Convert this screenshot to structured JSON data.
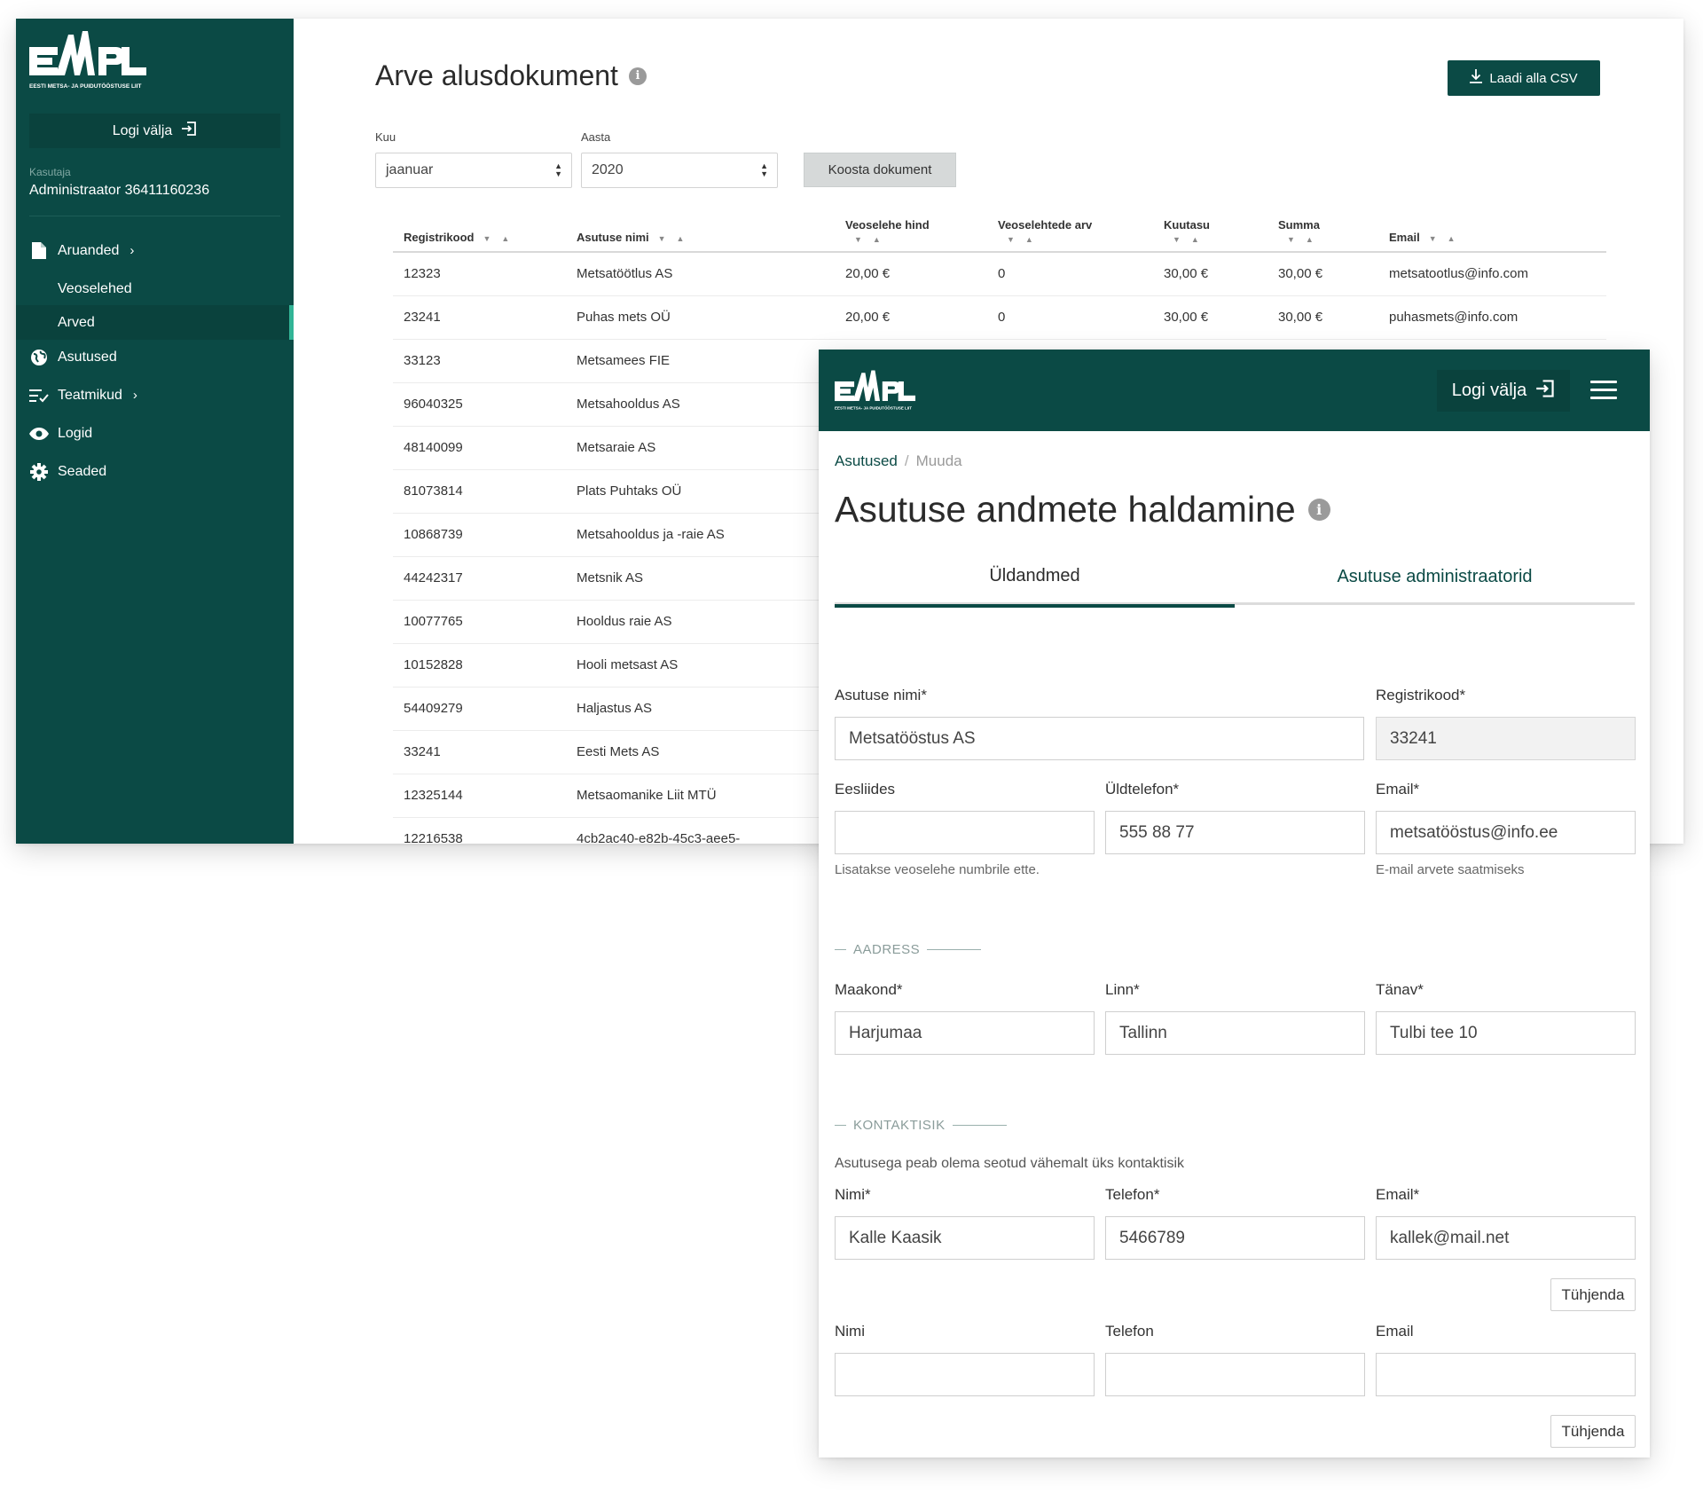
{
  "brand": {
    "logo_text": "EMPL",
    "logo_subtitle": "EESTI METSA- JA PUIDUTÖÖSTUSE LIIT",
    "primary_color": "#0b4a45",
    "accent_color": "#32b496"
  },
  "sidebar": {
    "logout_label": "Logi välja",
    "user_label": "Kasutaja",
    "user_name": "Administraator 36411160236",
    "items": [
      {
        "label": "Aruanded",
        "icon": "document-icon",
        "has_chevron": true
      },
      {
        "label": "Veoselehed",
        "sub": true
      },
      {
        "label": "Arved",
        "sub": true,
        "active": true
      },
      {
        "label": "Asutused",
        "icon": "globe-icon"
      },
      {
        "label": "Teatmikud",
        "icon": "checklist-icon",
        "has_chevron": true
      },
      {
        "label": "Logid",
        "icon": "eye-icon"
      },
      {
        "label": "Seaded",
        "icon": "gear-icon"
      }
    ]
  },
  "invoice": {
    "title": "Arve alusdokument",
    "csv_label": "Laadi alla CSV",
    "month_label": "Kuu",
    "month_value": "jaanuar",
    "year_label": "Aasta",
    "year_value": "2020",
    "build_label": "Koosta dokument",
    "columns": [
      "Registrikood",
      "Asutuse nimi",
      "Veoselehe hind",
      "Veoselehtede arv",
      "Kuutasu",
      "Summa",
      "Email"
    ],
    "rows": [
      [
        "12323",
        "Metsatöötlus AS",
        "20,00 €",
        "0",
        "30,00 €",
        "30,00 €",
        "metsatootlus@info.com"
      ],
      [
        "23241",
        "Puhas mets OÜ",
        "20,00 €",
        "0",
        "30,00 €",
        "30,00 €",
        "puhasmets@info.com"
      ],
      [
        "33123",
        "Metsamees FIE",
        "",
        "",
        "",
        "",
        ""
      ],
      [
        "96040325",
        "Metsahooldus AS",
        "",
        "",
        "",
        "",
        ""
      ],
      [
        "48140099",
        "Metsaraie AS",
        "",
        "",
        "",
        "",
        ""
      ],
      [
        "81073814",
        "Plats Puhtaks OÜ",
        "",
        "",
        "",
        "",
        ""
      ],
      [
        "10868739",
        "Metsahooldus ja -raie AS",
        "",
        "",
        "",
        "",
        ""
      ],
      [
        "44242317",
        "Metsnik AS",
        "",
        "",
        "",
        "",
        ""
      ],
      [
        "10077765",
        "Hooldus raie AS",
        "",
        "",
        "",
        "",
        ""
      ],
      [
        "10152828",
        "Hooli metsast AS",
        "",
        "",
        "",
        "",
        ""
      ],
      [
        "54409279",
        "Haljastus AS",
        "",
        "",
        "",
        "",
        ""
      ],
      [
        "33241",
        "Eesti Mets AS",
        "",
        "",
        "",
        "",
        ""
      ],
      [
        "12325144",
        "Metsaomanike Liit MTÜ",
        "",
        "",
        "",
        "",
        ""
      ],
      [
        "12216538",
        "4cb2ac40-e82b-45c3-aee5-",
        "",
        "",
        "",
        "",
        ""
      ]
    ]
  },
  "form": {
    "logout_label": "Logi välja",
    "breadcrumb": [
      "Asutused",
      "Muuda"
    ],
    "title": "Asutuse andmete haldamine",
    "tabs": [
      "Üldandmed",
      "Asutuse administraatorid"
    ],
    "fields": {
      "name_label": "Asutuse nimi*",
      "name_value": "Metsatööstus AS",
      "regcode_label": "Registrikood*",
      "regcode_value": "33241",
      "prefix_label": "Eesliides",
      "prefix_value": "",
      "prefix_hint": "Lisatakse veoselehe numbrile ette.",
      "phone_label": "Üldtelefon*",
      "phone_value": "555 88 77",
      "email_label": "Email*",
      "email_value": "metsatööstus@info.ee",
      "email_hint": "E-mail arvete saatmiseks"
    },
    "address": {
      "section": "AADRESS",
      "county_label": "Maakond*",
      "county_value": "Harjumaa",
      "city_label": "Linn*",
      "city_value": "Tallinn",
      "street_label": "Tänav*",
      "street_value": "Tulbi tee 10"
    },
    "contact": {
      "section": "KONTAKTISIK",
      "note": "Asutusega peab olema seotud vähemalt üks kontaktisik",
      "entries": [
        {
          "name_label": "Nimi*",
          "name_value": "Kalle Kaasik",
          "phone_label": "Telefon*",
          "phone_value": "5466789",
          "email_label": "Email*",
          "email_value": "kallek@mail.net",
          "clear_label": "Tühjenda"
        },
        {
          "name_label": "Nimi",
          "name_value": "",
          "phone_label": "Telefon",
          "phone_value": "",
          "email_label": "Email",
          "email_value": "",
          "clear_label": "Tühjenda"
        }
      ]
    }
  }
}
